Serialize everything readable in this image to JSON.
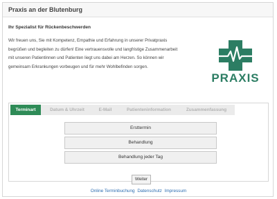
{
  "header": {
    "title": "Praxis an der Blutenburg"
  },
  "intro": {
    "title": "Ihr Spezialist für Rückenbeschwerden",
    "lines": [
      "Wir freuen uns, Sie mit Kompetenz, Empathie und Erfahrung in unserer Privatpraxis",
      "begrüßen und begleiten zu dürfen! Eine vertrauensvolle und langfristige Zusammenarbeit",
      "mit unseren Patientinnen und Patienten liegt uns dabei am Herzen. So können wir",
      "gemeinsam Erkrankungen vorbeugen und für mehr Wohlbefinden sorgen."
    ]
  },
  "logo": {
    "text": "PRAXIS",
    "color": "#2c7d63"
  },
  "tabs": [
    {
      "label": "Terminart",
      "active": true
    },
    {
      "label": "Datum & Uhrzeit",
      "active": false
    },
    {
      "label": "E-Mail",
      "active": false
    },
    {
      "label": "Patienteninformation",
      "active": false
    },
    {
      "label": "Zusammenfassung",
      "active": false
    }
  ],
  "options": [
    {
      "label": "Ersttermin"
    },
    {
      "label": "Behandlung"
    },
    {
      "label": "Behandlung jeder Tag"
    }
  ],
  "next_button": {
    "label": "Weiter"
  },
  "footer": {
    "links": [
      {
        "label": "Online Terminbuchung"
      },
      {
        "label": "Datenschutz"
      },
      {
        "label": "Impressum"
      }
    ]
  },
  "colors": {
    "accent": "#2e8b57",
    "link": "#2b6cb0"
  }
}
